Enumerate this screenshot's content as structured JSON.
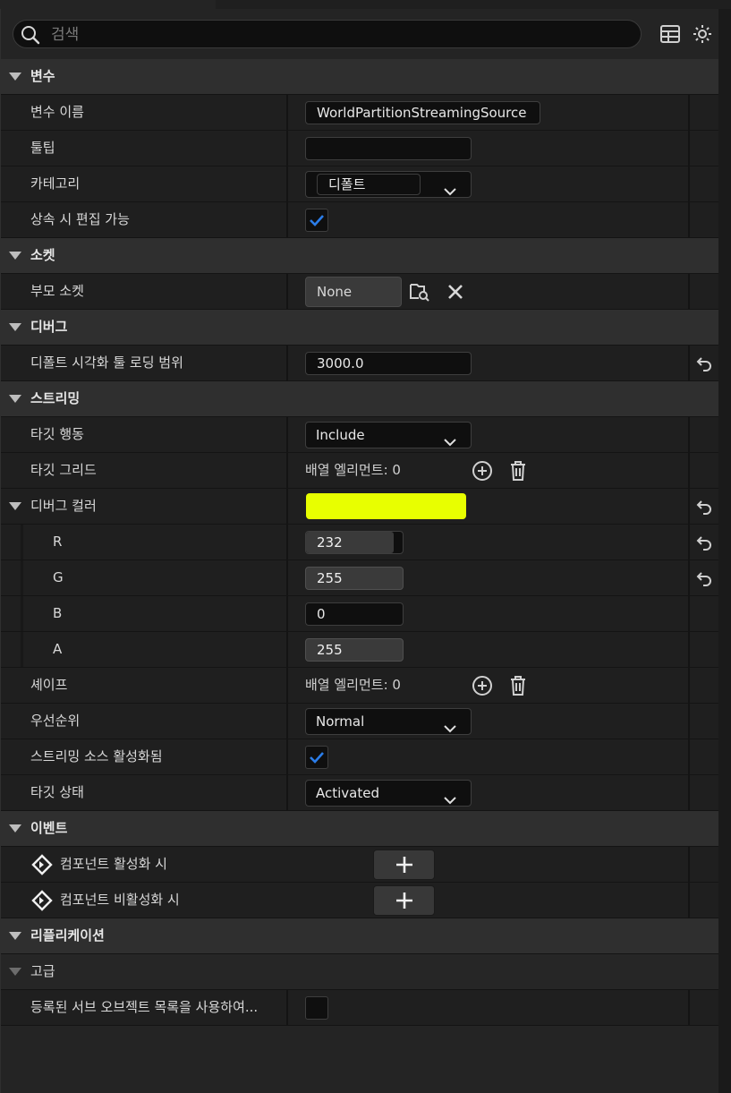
{
  "search": {
    "placeholder": "검색"
  },
  "toolbar": {
    "table_icon": "table-view-icon",
    "settings_icon": "gear-icon"
  },
  "sections": {
    "variable": {
      "title": "변수",
      "var_name_label": "변수 이름",
      "var_name_value": "WorldPartitionStreamingSource",
      "tooltip_label": "툴팁",
      "tooltip_value": "",
      "category_label": "카테고리",
      "category_value": "디폴트",
      "editable_label": "상속 시 편집 가능",
      "editable_checked": true
    },
    "socket": {
      "title": "소켓",
      "parent_socket_label": "부모 소켓",
      "parent_socket_value": "None"
    },
    "debug": {
      "title": "디버그",
      "vis_range_label": "디폴트 시각화 툴 로딩 범위",
      "vis_range_value": "3000.0"
    },
    "streaming": {
      "title": "스트리밍",
      "target_behavior_label": "타깃 행동",
      "target_behavior_value": "Include",
      "target_grids_label": "타깃 그리드",
      "target_grids_value": "배열 엘리먼트: 0",
      "debug_color_label": "디버그 컬러",
      "debug_color_hex": "#e8ff00",
      "r_label": "R",
      "r_value": "232",
      "r_fraction": 0.91,
      "g_label": "G",
      "g_value": "255",
      "g_fraction": 1.0,
      "b_label": "B",
      "b_value": "0",
      "b_fraction": 0.0,
      "a_label": "A",
      "a_value": "255",
      "a_fraction": 1.0,
      "shapes_label": "셰이프",
      "shapes_value": "배열 엘리먼트: 0",
      "priority_label": "우선순위",
      "priority_value": "Normal",
      "source_enabled_label": "스트리밍 소스 활성화됨",
      "source_enabled_checked": true,
      "target_state_label": "타깃 상태",
      "target_state_value": "Activated"
    },
    "events": {
      "title": "이벤트",
      "on_activated_label": "컴포넌트 활성화 시",
      "on_deactivated_label": "컴포넌트 비활성화 시"
    },
    "replication": {
      "title": "리플리케이션",
      "advanced_label": "고급",
      "use_subobject_list_label": "등록된 서브 오브젝트 목록을 사용하여...",
      "use_subobject_list_checked": false
    }
  },
  "colors": {
    "accent_check": "#2b7de9",
    "panel": "#242424",
    "row": "#1f1f1f",
    "category": "#2f2f2f"
  }
}
